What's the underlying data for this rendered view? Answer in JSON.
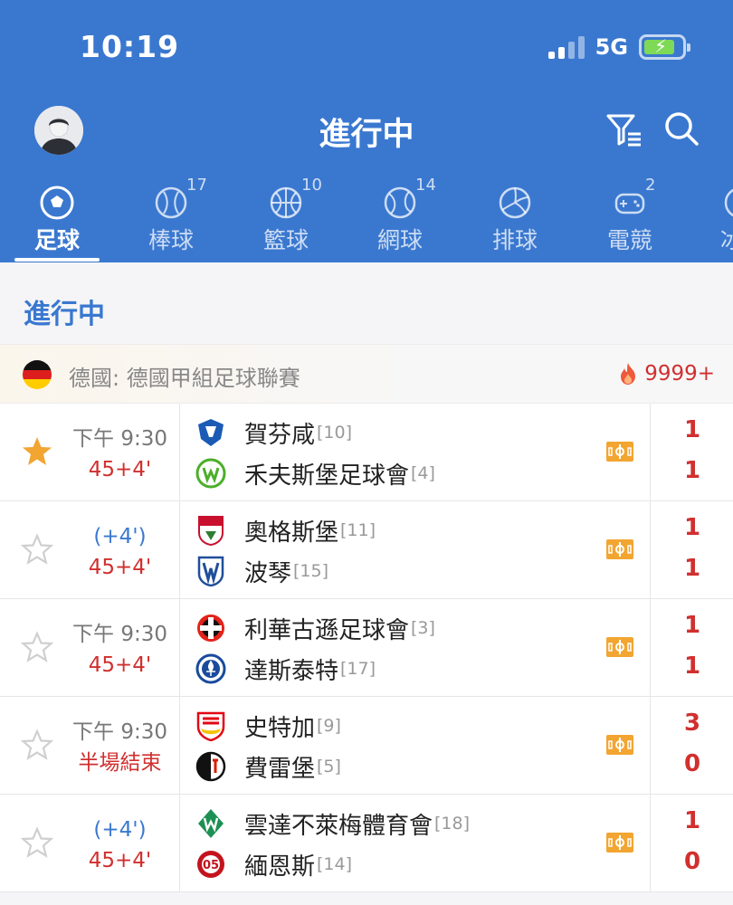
{
  "status": {
    "time": "10:19",
    "network": "5G"
  },
  "header": {
    "title": "進行中"
  },
  "tabs": [
    {
      "label": "足球",
      "count": "",
      "icon": "soccer-ball-icon",
      "active": true
    },
    {
      "label": "棒球",
      "count": "17",
      "icon": "baseball-icon"
    },
    {
      "label": "籃球",
      "count": "10",
      "icon": "basketball-icon"
    },
    {
      "label": "網球",
      "count": "14",
      "icon": "tennis-ball-icon"
    },
    {
      "label": "排球",
      "count": "",
      "icon": "volleyball-icon"
    },
    {
      "label": "電競",
      "count": "2",
      "icon": "gamepad-icon"
    },
    {
      "label": "冰",
      "count": "",
      "icon": "hockey-icon"
    }
  ],
  "section": {
    "title": "進行中"
  },
  "league": {
    "name": "德國: 德國甲組足球聯賽",
    "hot_count": "9999+"
  },
  "matches": [
    {
      "favorite": true,
      "line1": "下午 9:30",
      "line2": "45+4'",
      "home": "賀芬咸",
      "home_rank": "[10]",
      "away": "禾夫斯堡足球會",
      "away_rank": "[4]",
      "home_score": "1",
      "away_score": "1"
    },
    {
      "favorite": false,
      "line1": "(+4')",
      "line2": "45+4'",
      "home": "奧格斯堡",
      "home_rank": "[11]",
      "away": "波琴",
      "away_rank": "[15]",
      "home_score": "1",
      "away_score": "1"
    },
    {
      "favorite": false,
      "line1": "下午 9:30",
      "line2": "45+4'",
      "home": "利華古遜足球會",
      "home_rank": "[3]",
      "away": "達斯泰特",
      "away_rank": "[17]",
      "home_score": "1",
      "away_score": "1"
    },
    {
      "favorite": false,
      "line1": "下午 9:30",
      "line2": "半場結束",
      "home": "史特加",
      "home_rank": "[9]",
      "away": "費雷堡",
      "away_rank": "[5]",
      "home_score": "3",
      "away_score": "0"
    },
    {
      "favorite": false,
      "line1": "(+4')",
      "line2": "45+4'",
      "home": "雲達不萊梅體育會",
      "home_rank": "[18]",
      "away": "緬恩斯",
      "away_rank": "[14]",
      "home_score": "1",
      "away_score": "0"
    }
  ],
  "colors": {
    "header_bg": "#3a78d0",
    "live_red": "#d0302f",
    "star_gold": "#f2a531"
  }
}
